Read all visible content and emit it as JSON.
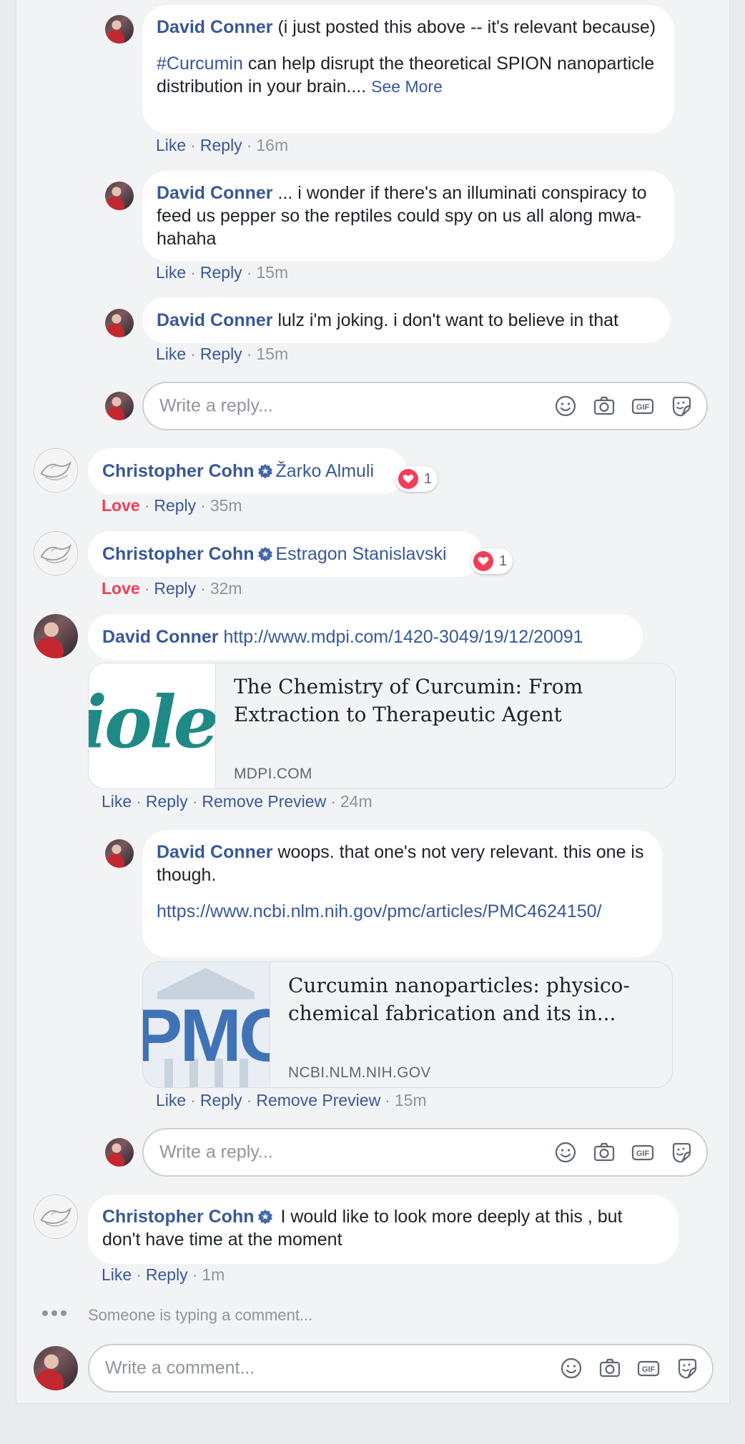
{
  "comments": {
    "c1": {
      "author": "David Conner",
      "text1": " (i just posted this above -- it's relevant because)",
      "hashtag": "#Curcumin",
      "text2": " can help disrupt the theoretical SPION nanoparticle distribution in your brain.... ",
      "see_more": "See More",
      "like": "Like",
      "reply": "Reply",
      "time": "16m"
    },
    "c2": {
      "author": "David Conner",
      "text": " ... i wonder if there's an illuminati conspiracy to feed us pepper so the reptiles could spy on us all along mwa-hahaha",
      "like": "Like",
      "reply": "Reply",
      "time": "15m"
    },
    "c3": {
      "author": "David Conner",
      "text": " lulz i'm joking. i don't want to believe in that",
      "like": "Like",
      "reply": "Reply",
      "time": "15m"
    },
    "reply_box_1": {
      "placeholder": "Write a reply..."
    },
    "c4": {
      "author": "Christopher Cohn",
      "mention": "Žarko Almuli",
      "reaction_count": "1",
      "love": "Love",
      "reply": "Reply",
      "time": "35m"
    },
    "c5": {
      "author": "Christopher Cohn",
      "mention": "Estragon Stanislavski",
      "reaction_count": "1",
      "love": "Love",
      "reply": "Reply",
      "time": "32m"
    },
    "c6": {
      "author": "David Conner",
      "url": "http://www.mdpi.com/1420-3049/19/12/20091",
      "preview_image_text": "iole",
      "preview_title": "The Chemistry of Curcumin: From Extraction to Therapeutic Agent",
      "preview_domain": "MDPI.COM",
      "like": "Like",
      "reply": "Reply",
      "remove_preview": "Remove Preview",
      "time": "24m"
    },
    "c7": {
      "author": "David Conner",
      "text": " woops. that one's not very relevant. this one is though.",
      "url": "https://www.ncbi.nlm.nih.gov/pmc/articles/PMC4624150/",
      "preview_image_text": "PMC",
      "preview_title": "Curcumin nanoparticles: physico-chemical fabrication and its in...",
      "preview_domain": "NCBI.NLM.NIH.GOV",
      "like": "Like",
      "reply": "Reply",
      "remove_preview": "Remove Preview",
      "time": "15m"
    },
    "reply_box_2": {
      "placeholder": "Write a reply..."
    },
    "c8": {
      "author": "Christopher Cohn",
      "text": " I would like to look more deeply at this , but don't have time at the moment",
      "like": "Like",
      "reply": "Reply",
      "time": "1m"
    }
  },
  "typing_indicator": "Someone is typing a comment...",
  "comment_box": {
    "placeholder": "Write a comment..."
  },
  "icons": {
    "emoji": "emoji-icon",
    "camera": "camera-icon",
    "gif": "gif-icon",
    "sticker": "sticker-icon",
    "verified": "verified-badge-icon",
    "heart": "love-reaction-icon"
  },
  "colors": {
    "link": "#385898",
    "love": "#f33e58",
    "meta": "#90949c",
    "bubble": "#ffffff",
    "background": "#f2f3f5"
  }
}
